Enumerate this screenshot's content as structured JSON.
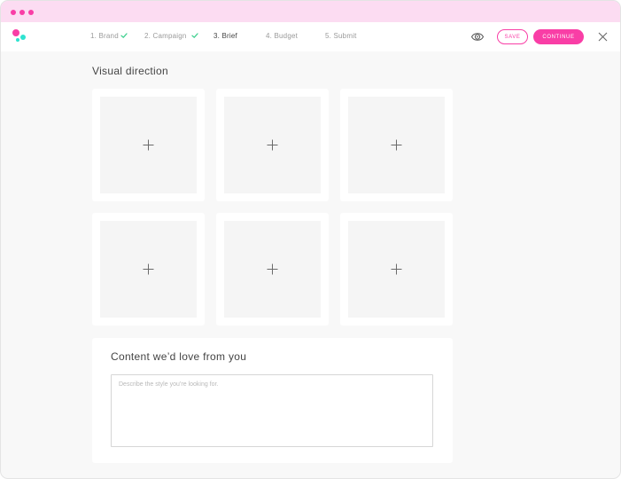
{
  "colors": {
    "accent": "#f93ea6",
    "accent_light": "#fcdcf2",
    "teal": "#2ee3d0",
    "check_green": "#3dcf8e"
  },
  "window": {
    "controls": [
      "window-dot",
      "window-dot",
      "window-dot"
    ]
  },
  "header": {
    "logo_icon": "brand-logo-icon",
    "steps": [
      {
        "label": "1. Brand",
        "completed": true,
        "active": false
      },
      {
        "label": "2. Campaign",
        "completed": true,
        "active": false
      },
      {
        "label": "3. Brief",
        "completed": false,
        "active": true
      },
      {
        "label": "4. Budget",
        "completed": false,
        "active": false
      },
      {
        "label": "5. Submit",
        "completed": false,
        "active": false
      }
    ],
    "preview_icon": "eye-icon",
    "save_label": "SAVE",
    "continue_label": "CONTINUE",
    "close_icon": "close-icon"
  },
  "visual_direction": {
    "title": "Visual direction",
    "tiles": [
      {
        "icon": "plus-icon"
      },
      {
        "icon": "plus-icon"
      },
      {
        "icon": "plus-icon"
      },
      {
        "icon": "plus-icon"
      },
      {
        "icon": "plus-icon"
      },
      {
        "icon": "plus-icon"
      }
    ]
  },
  "content": {
    "title": "Content we’d love from you",
    "placeholder": "Describe the style you’re looking for.",
    "value": ""
  }
}
